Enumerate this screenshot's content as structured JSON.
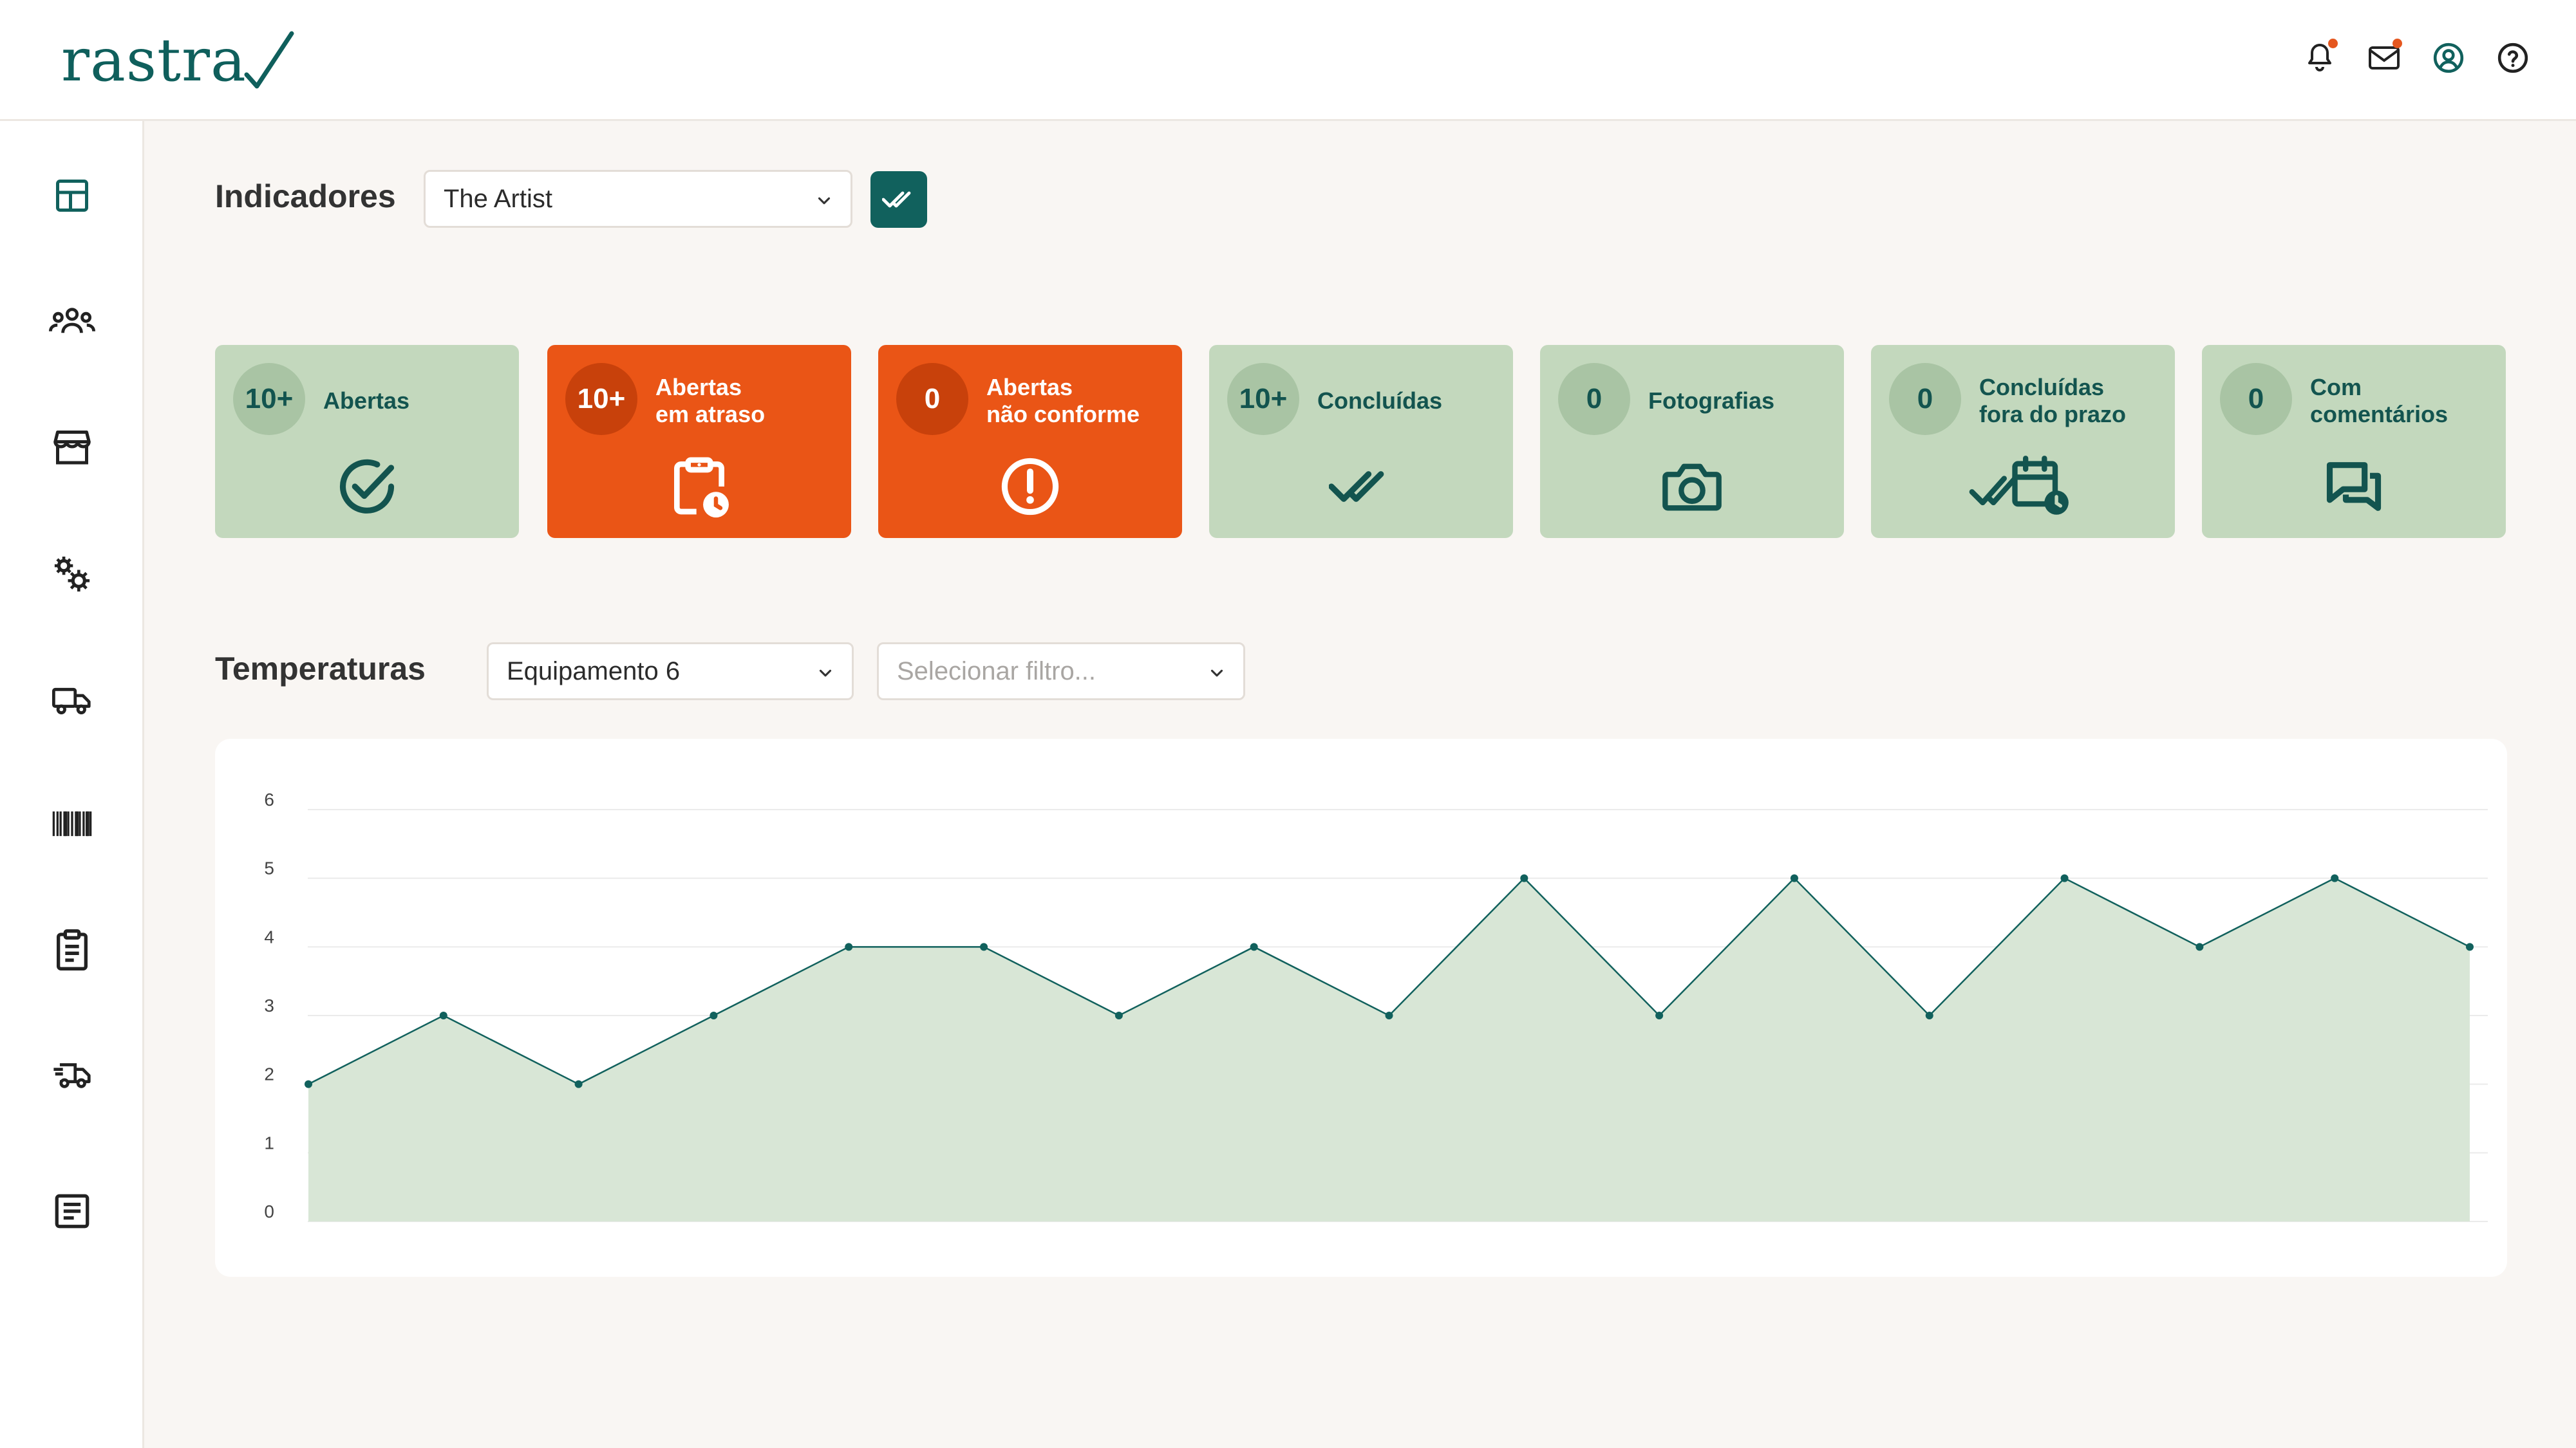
{
  "app": {
    "logo_text": "rastra"
  },
  "header": {
    "icons": [
      "bell-icon",
      "mail-icon",
      "user-circle-icon",
      "help-icon"
    ],
    "accent": "#e5571f"
  },
  "sidebar": {
    "items": [
      "dashboard-icon",
      "users-group-icon",
      "store-icon",
      "settings-icon",
      "truck-icon",
      "barcode-icon",
      "clipboard-icon",
      "delivery-truck-icon",
      "document-icon"
    ]
  },
  "indicators": {
    "title": "Indicadores",
    "select_value": "The Artist",
    "cards": [
      {
        "count": "10+",
        "label": "Abertas",
        "icon": "circle-check-icon",
        "alert": false
      },
      {
        "count": "10+",
        "label": "Abertas\nem atraso",
        "icon": "clipboard-clock-icon",
        "alert": true
      },
      {
        "count": "0",
        "label": "Abertas\nnão conforme",
        "icon": "exclamation-circle-icon",
        "alert": true
      },
      {
        "count": "10+",
        "label": "Concluídas",
        "icon": "double-check-icon",
        "alert": false
      },
      {
        "count": "0",
        "label": "Fotografias",
        "icon": "camera-icon",
        "alert": false
      },
      {
        "count": "0",
        "label": "Concluídas\nfora do prazo",
        "icon": "check-calendar-clock-icon",
        "alert": false
      },
      {
        "count": "0",
        "label": "Com\ncomentários",
        "icon": "chat-bubbles-icon",
        "alert": false
      }
    ]
  },
  "temperatures": {
    "title": "Temperaturas",
    "equipment_value": "Equipamento 6",
    "filter_placeholder": "Selecionar filtro..."
  },
  "colors": {
    "primary": "#11615d",
    "card_green": "#c3d8bd",
    "card_alert": "#ea5516",
    "area_fill": "#d8e6d6"
  },
  "chart_data": {
    "type": "area",
    "x": [
      1,
      2,
      3,
      4,
      5,
      6,
      7,
      8,
      9,
      10,
      11,
      12,
      13,
      14,
      15,
      16,
      17
    ],
    "values": [
      2,
      3,
      2,
      3,
      4,
      4,
      3,
      4,
      3,
      5,
      3,
      5,
      3,
      5,
      4,
      5,
      4
    ],
    "yticks": [
      "0",
      "1",
      "2",
      "3",
      "4",
      "5",
      "6"
    ],
    "ylim": [
      0,
      6
    ],
    "grid": true,
    "legend": "none"
  }
}
